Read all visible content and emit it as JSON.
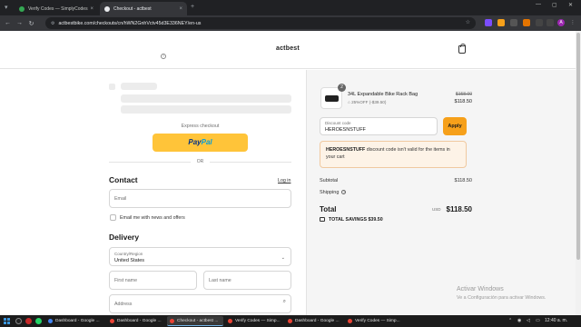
{
  "browser": {
    "tabs": [
      {
        "label": "Verify Codes — SimplyCodes",
        "active": false
      },
      {
        "label": "Checkout - actbest",
        "active": true
      }
    ],
    "new_tab": "+",
    "url": "actbestbike.com/checkouts/cn/hWN2GnhVctv45d3E336NEY/en-us"
  },
  "site": {
    "logo": "actbest"
  },
  "express": {
    "label": "Express checkout",
    "paypal_1": "Pay",
    "paypal_2": "Pal",
    "or": "OR"
  },
  "contact": {
    "title": "Contact",
    "login": "Log in",
    "email_placeholder": "Email",
    "newsletter_label": "Email me with news and offers"
  },
  "delivery": {
    "title": "Delivery",
    "country_label": "Country/Region",
    "country_value": "United States",
    "first_name_placeholder": "First name",
    "last_name_placeholder": "Last name",
    "address_placeholder": "Address"
  },
  "summary": {
    "quantity": "2",
    "product_name": "34L Expandable Bike Rack Bag",
    "discount_text": "25%OFF (-$39.50)",
    "price_old": "$158.00",
    "price_new": "$118.50",
    "discount_label": "Discount code",
    "discount_value": "HEROESNSTUFF",
    "apply": "Apply",
    "alert_code": "HEROESNSTUFF",
    "alert_text": "discount code isn't valid for the items in your cart",
    "subtotal_label": "Subtotal",
    "subtotal_value": "$118.50",
    "shipping_label": "Shipping",
    "total_label": "Total",
    "currency": "USD",
    "total_value": "$118.50",
    "savings": "TOTAL SAVINGS  $39.50"
  },
  "windows": {
    "watermark_title": "Activar Windows",
    "watermark_sub": "Ve a Configuración para activar Windows.",
    "taskbar": [
      {
        "label": "Dashboard - Google ...",
        "color": "#4285f4"
      },
      {
        "label": "Dashboard - Google ...",
        "color": "#ea4335"
      },
      {
        "label": "Checkout - actbest ...",
        "color": "#ea4335"
      },
      {
        "label": "Verify Codes — Simp...",
        "color": "#ea4335"
      },
      {
        "label": "Dashboard - Google ...",
        "color": "#ea4335"
      },
      {
        "label": "Verify Codes — Simp...",
        "color": "#ea4335"
      }
    ],
    "clock": "12:40 a. m."
  }
}
